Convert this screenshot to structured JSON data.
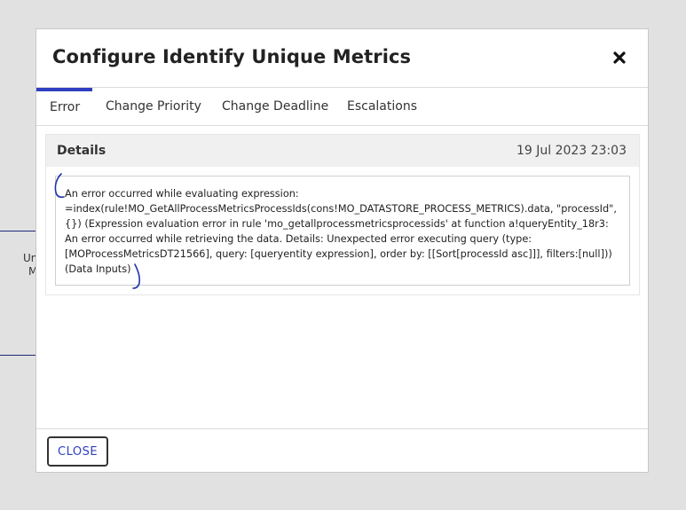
{
  "background": {
    "fragments": [
      "Un",
      "M"
    ]
  },
  "dialog": {
    "title": "Configure Identify Unique Metrics",
    "close_icon": "close-icon",
    "tabs": [
      {
        "label": "Error",
        "active": true
      },
      {
        "label": "Change Priority",
        "active": false
      },
      {
        "label": "Change Deadline",
        "active": false
      },
      {
        "label": "Escalations",
        "active": false
      }
    ],
    "details": {
      "label": "Details",
      "timestamp": "19 Jul 2023 23:03"
    },
    "error_message": "An error occurred while evaluating expression: =index(rule!MO_GetAllProcessMetricsProcessIds(cons!MO_DATASTORE_PROCESS_METRICS).data, \"processId\", {}) (Expression evaluation error in rule 'mo_getallprocessmetricsprocessids' at function a!queryEntity_18r3: An error occurred while retrieving the data. Details: Unexpected error executing query (type: [MOProcessMetricsDT21566], query: [queryentity expression], order by: [[Sort[processId asc]]], filters:[null])) (Data Inputs)",
    "footer": {
      "close_label": "CLOSE"
    }
  },
  "colors": {
    "accent": "#2f3fbf",
    "annotation": "#2233aa"
  }
}
